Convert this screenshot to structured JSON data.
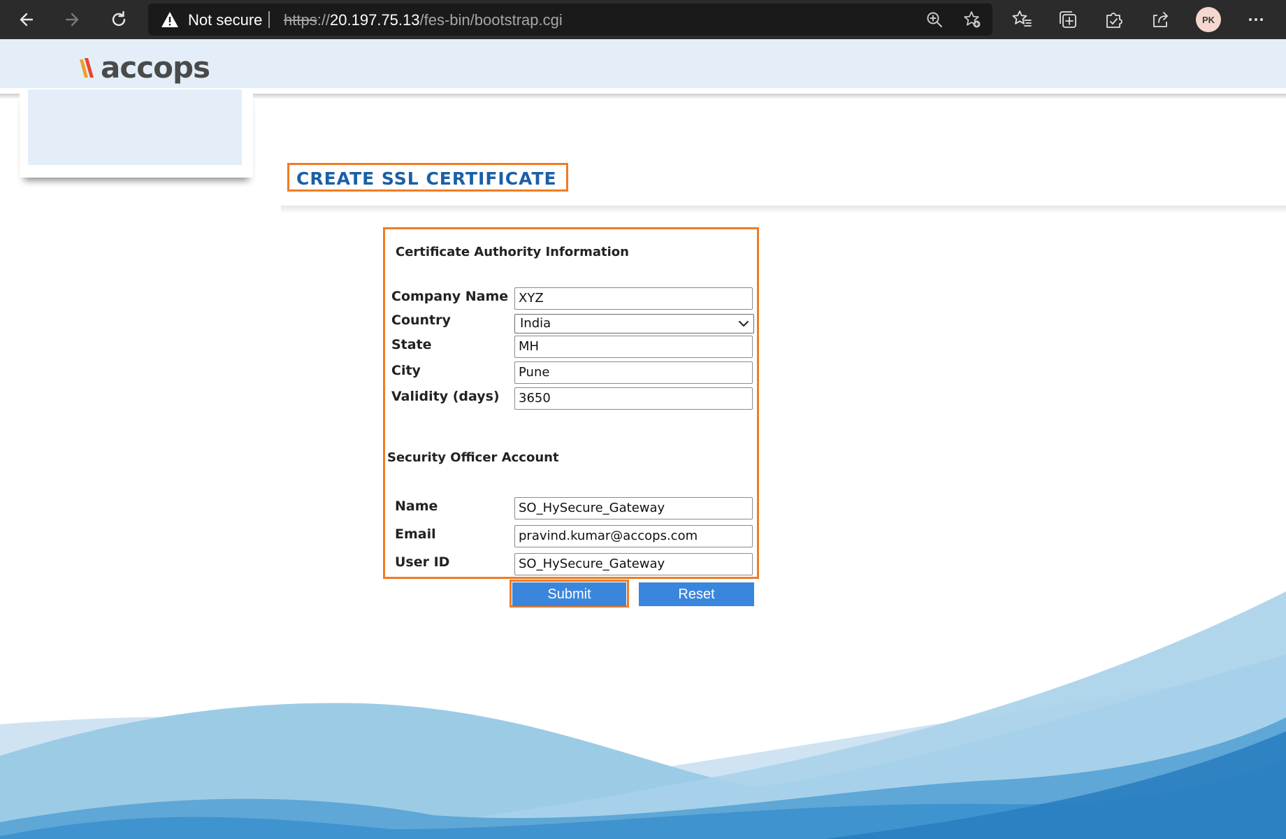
{
  "browser": {
    "not_secure_label": "Not secure",
    "url_scheme": "https",
    "url_sep": "://",
    "url_host": "20.197.75.13",
    "url_path": "/fes-bin/bootstrap.cgi",
    "profile_initials": "PK"
  },
  "brand": {
    "logo_text": "accops",
    "accent_colors": [
      "#f07c23",
      "#e8442c"
    ]
  },
  "page": {
    "title": "CREATE SSL CERTIFICATE"
  },
  "ca_section": {
    "title": "Certificate Authority Information",
    "company_label": "Company Name",
    "company_value": "XYZ",
    "country_label": "Country",
    "country_value": "India",
    "state_label": "State",
    "state_value": "MH",
    "city_label": "City",
    "city_value": "Pune",
    "validity_label": "Validity (days)",
    "validity_value": "3650"
  },
  "so_section": {
    "title": "Security Officer Account",
    "name_label": "Name",
    "name_value": "SO_HySecure_Gateway",
    "email_label": "Email",
    "email_value": "pravind.kumar@accops.com",
    "userid_label": "User ID",
    "userid_value": "SO_HySecure_Gateway"
  },
  "actions": {
    "submit_label": "Submit",
    "reset_label": "Reset"
  },
  "colors": {
    "highlight": "#f07c23",
    "title_blue": "#1b5fa7",
    "button_blue": "#3b86dd",
    "header_band": "#e3eef8"
  }
}
